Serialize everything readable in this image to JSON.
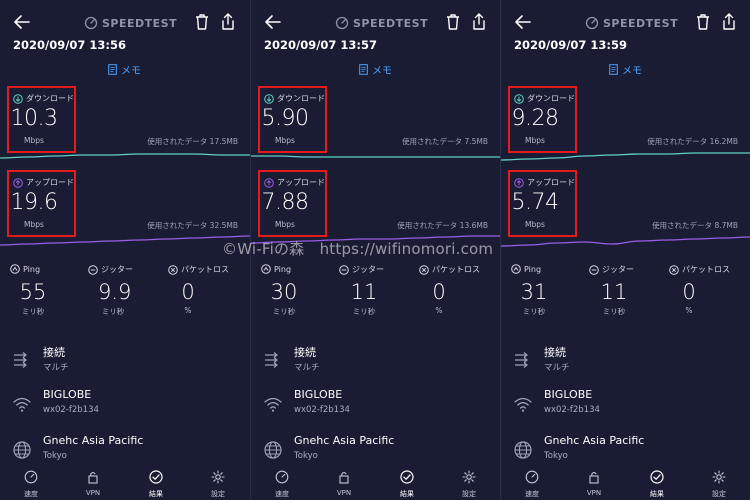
{
  "app": {
    "brand": "SPEEDTEST",
    "memo_label": "メモ",
    "download_title": "ダウンロード",
    "upload_title": "アップロード",
    "speed_unit": "Mbps",
    "used_label": "使用されたデータ",
    "ping_title": "Ping",
    "jitter_title": "ジッター",
    "loss_title": "パケットロス",
    "ms_unit": "ミリ秒",
    "percent_unit": "%",
    "connection_title": "接続",
    "connection_value": "マルチ",
    "isp_name": "BIGLOBE",
    "isp_host": "wx02-f2b134",
    "server_name": "Gnehc Asia Pacific",
    "server_city": "Tokyo"
  },
  "nav": {
    "speed": "速度",
    "vpn": "VPN",
    "results": "結果",
    "settings": "設定"
  },
  "results": [
    {
      "timestamp": "2020/09/07 13:56",
      "download": "10.3",
      "download_used": "17.5MB",
      "upload": "19.6",
      "upload_used": "32.5MB",
      "ping": "55",
      "jitter": "9.9",
      "loss": "0"
    },
    {
      "timestamp": "2020/09/07 13:57",
      "download": "5.90",
      "download_used": "7.5MB",
      "upload": "7.88",
      "upload_used": "13.6MB",
      "ping": "30",
      "jitter": "11",
      "loss": "0"
    },
    {
      "timestamp": "2020/09/07 13:59",
      "download": "9.28",
      "download_used": "16.2MB",
      "upload": "5.74",
      "upload_used": "8.7MB",
      "ping": "31",
      "jitter": "11",
      "loss": "0"
    }
  ],
  "colors": {
    "background": "#1a1c33",
    "download_line": "#5fd3c6",
    "upload_line": "#9b5ee8",
    "highlight_box": "#e21b1b",
    "memo": "#4aa3ff"
  },
  "watermark": "©Wi-Fiの森　https://wifinomori.com"
}
